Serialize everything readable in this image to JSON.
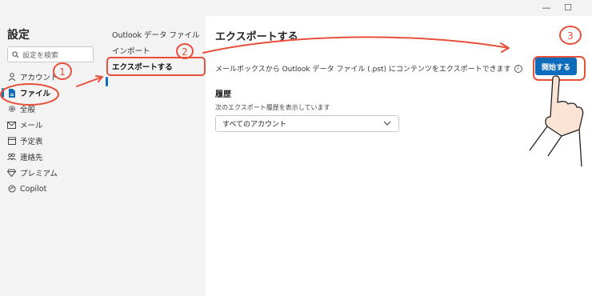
{
  "window": {
    "minimize_glyph": "—",
    "maximize_glyph": "☐"
  },
  "sidebar": {
    "title": "設定",
    "search_placeholder": "設定を検索",
    "items": [
      {
        "label": "アカウント",
        "icon": "person-icon"
      },
      {
        "label": "ファイル",
        "icon": "file-icon",
        "active": true
      },
      {
        "label": "全般",
        "icon": "gear-icon"
      },
      {
        "label": "メール",
        "icon": "mail-icon"
      },
      {
        "label": "予定表",
        "icon": "calendar-icon"
      },
      {
        "label": "連絡先",
        "icon": "people-icon"
      },
      {
        "label": "プレミアム",
        "icon": "diamond-icon"
      },
      {
        "label": "Copilot",
        "icon": "copilot-icon"
      }
    ]
  },
  "subnav": {
    "items": [
      {
        "label": "Outlook データ ファイル"
      },
      {
        "label": "インポート"
      },
      {
        "label": "エクスポートする",
        "active": true
      }
    ]
  },
  "main": {
    "title": "エクスポートする",
    "description": "メールボックスから Outlook データ ファイル (.pst) にコンテンツをエクスポートできます",
    "start_button": "開始する",
    "history_title": "履歴",
    "history_label": "次のエクスポート履歴を表示しています",
    "history_select_value": "すべてのアカウント"
  },
  "annotations": {
    "step1": "1",
    "step2": "2",
    "step3": "3",
    "color": "#e8503a"
  }
}
